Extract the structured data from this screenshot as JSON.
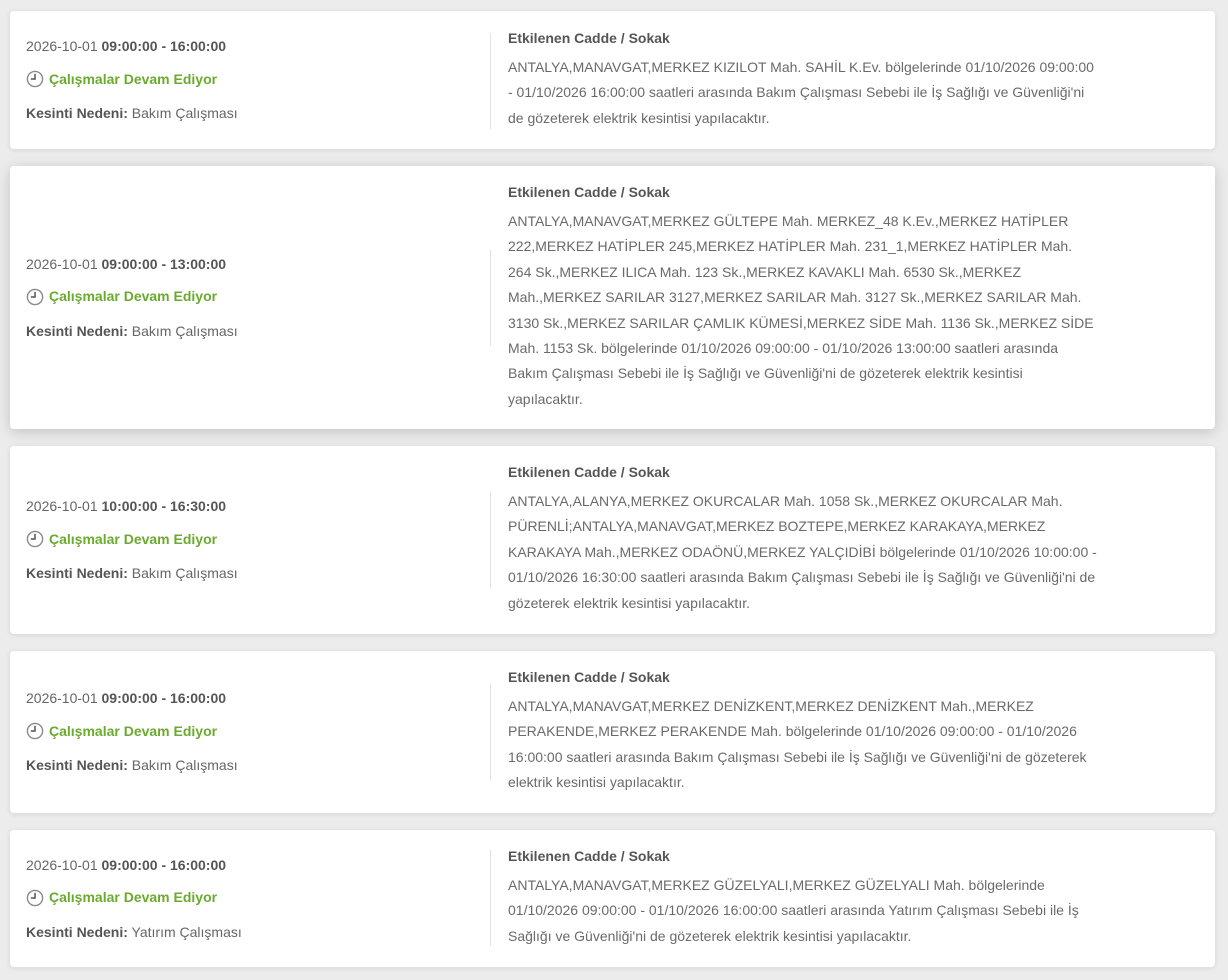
{
  "outages": [
    {
      "date": "2026-10-01",
      "time": "09:00:00 - 16:00:00",
      "status": "Çalışmalar Devam Ediyor",
      "reason_label": "Kesinti Nedeni:",
      "reason": "Bakım Çalışması",
      "affected_title": "Etkilenen Cadde / Sokak",
      "affected_text": "ANTALYA,MANAVGAT,MERKEZ KIZILOT Mah. SAHİL K.Ev. bölgelerinde 01/10/2026 09:00:00 - 01/10/2026 16:00:00 saatleri arasında Bakım Çalışması Sebebi ile İş Sağlığı ve Güvenliği'ni de gözeterek elektrik kesintisi yapılacaktır."
    },
    {
      "date": "2026-10-01",
      "time": "09:00:00 - 13:00:00",
      "status": "Çalışmalar Devam Ediyor",
      "reason_label": "Kesinti Nedeni:",
      "reason": "Bakım Çalışması",
      "affected_title": "Etkilenen Cadde / Sokak",
      "affected_text": "ANTALYA,MANAVGAT,MERKEZ GÜLTEPE Mah. MERKEZ_48 K.Ev.,MERKEZ HATİPLER 222,MERKEZ HATİPLER 245,MERKEZ HATİPLER Mah. 231_1,MERKEZ HATİPLER Mah. 264 Sk.,MERKEZ ILICA Mah. 123 Sk.,MERKEZ KAVAKLI Mah. 6530 Sk.,MERKEZ Mah.,MERKEZ SARILAR 3127,MERKEZ SARILAR Mah. 3127 Sk.,MERKEZ SARILAR Mah. 3130 Sk.,MERKEZ SARILAR ÇAMLIK KÜMESİ,MERKEZ SİDE Mah. 1136 Sk.,MERKEZ SİDE Mah. 1153 Sk. bölgelerinde 01/10/2026 09:00:00 - 01/10/2026 13:00:00 saatleri arasında Bakım Çalışması Sebebi ile İş Sağlığı ve Güvenliği'ni de gözeterek elektrik kesintisi yapılacaktır."
    },
    {
      "date": "2026-10-01",
      "time": "10:00:00 - 16:30:00",
      "status": "Çalışmalar Devam Ediyor",
      "reason_label": "Kesinti Nedeni:",
      "reason": "Bakım Çalışması",
      "affected_title": "Etkilenen Cadde / Sokak",
      "affected_text": "ANTALYA,ALANYA,MERKEZ OKURCALAR Mah. 1058 Sk.,MERKEZ OKURCALAR Mah. PÜRENLİ;ANTALYA,MANAVGAT,MERKEZ BOZTEPE,MERKEZ KARAKAYA,MERKEZ KARAKAYA Mah.,MERKEZ ODAÖNÜ,MERKEZ YALÇIDİBİ bölgelerinde 01/10/2026 10:00:00 - 01/10/2026 16:30:00 saatleri arasında Bakım Çalışması Sebebi ile İş Sağlığı ve Güvenliği'ni de gözeterek elektrik kesintisi yapılacaktır."
    },
    {
      "date": "2026-10-01",
      "time": "09:00:00 - 16:00:00",
      "status": "Çalışmalar Devam Ediyor",
      "reason_label": "Kesinti Nedeni:",
      "reason": "Bakım Çalışması",
      "affected_title": "Etkilenen Cadde / Sokak",
      "affected_text": "ANTALYA,MANAVGAT,MERKEZ DENİZKENT,MERKEZ DENİZKENT Mah.,MERKEZ PERAKENDE,MERKEZ PERAKENDE Mah. bölgelerinde 01/10/2026 09:00:00 - 01/10/2026 16:00:00 saatleri arasında Bakım Çalışması Sebebi ile İş Sağlığı ve Güvenliği'ni de gözeterek elektrik kesintisi yapılacaktır."
    },
    {
      "date": "2026-10-01",
      "time": "09:00:00 - 16:00:00",
      "status": "Çalışmalar Devam Ediyor",
      "reason_label": "Kesinti Nedeni:",
      "reason": "Yatırım Çalışması",
      "affected_title": "Etkilenen Cadde / Sokak",
      "affected_text": "ANTALYA,MANAVGAT,MERKEZ GÜZELYALI,MERKEZ GÜZELYALI Mah. bölgelerinde 01/10/2026 09:00:00 - 01/10/2026 16:00:00 saatleri arasında Yatırım Çalışması Sebebi ile İş Sağlığı ve Güvenliği'ni de gözeterek elektrik kesintisi yapılacaktır."
    }
  ],
  "icons": {
    "status": "clock-icon"
  },
  "colors": {
    "status_green": "#6aab2f"
  }
}
